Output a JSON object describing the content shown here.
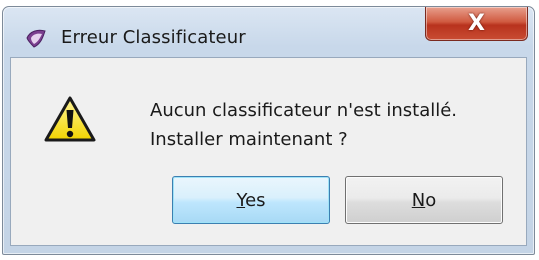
{
  "window": {
    "title": "Erreur Classificateur",
    "close_glyph": "X"
  },
  "dialog": {
    "icon": "warning-icon",
    "message_line1": "Aucun classificateur n'est installé.",
    "message_line2": "Installer maintenant ?"
  },
  "buttons": {
    "yes": {
      "mnemonic": "Y",
      "rest": "es"
    },
    "no": {
      "mnemonic": "N",
      "rest": "o"
    }
  },
  "colors": {
    "close_button": "#c94d33",
    "default_button_border": "#3c7fb1",
    "warning_fill": "#f5e012"
  }
}
